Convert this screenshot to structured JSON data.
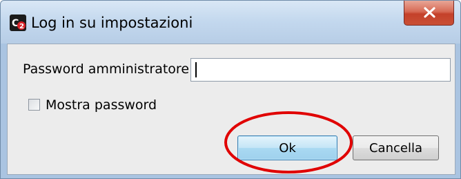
{
  "window": {
    "title": "Log in su impostazioni",
    "icon": "c2-app-icon",
    "close_icon": "close-icon"
  },
  "form": {
    "password_label": "Password amministratore",
    "password_value": "",
    "show_password_label": "Mostra password",
    "show_password_checked": false
  },
  "buttons": {
    "ok_label": "Ok",
    "cancel_label": "Cancella"
  },
  "annotation": {
    "shape": "ellipse",
    "color": "#e00000",
    "target": "ok-button"
  },
  "colors": {
    "title_gradient_top": "#d9e7f5",
    "client_bg": "#ececec",
    "close_red": "#c4412a",
    "ok_border": "#3c7fb1"
  }
}
